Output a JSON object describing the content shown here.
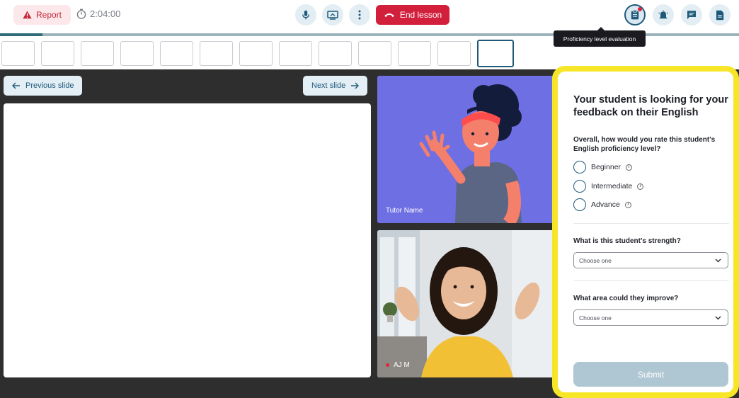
{
  "header": {
    "report_label": "Report",
    "timer": "2:04:00",
    "end_lesson_label": "End lesson"
  },
  "tooltip": "Proficiency level evaluation",
  "lesson": {
    "progress": 0.057,
    "slide_count": 13,
    "current_slide": 13,
    "prev_slide_label": "Previous slide",
    "next_slide_label": "Next slide"
  },
  "videos": {
    "tutor_name": "Tutor Name",
    "student_name": "AJ M"
  },
  "feedback": {
    "title": "Your student is looking for your feedback on their English",
    "q1": "Overall, how would you rate this student's English proficiency level?",
    "levels": [
      "Beginner",
      "Intermediate",
      "Advance"
    ],
    "q2": "What is this student's strength?",
    "q2_placeholder": "Choose one",
    "q3": "What area could they improve?",
    "q3_placeholder": "Choose one",
    "submit_label": "Submit"
  },
  "colors": {
    "accent": "#1f5a7a",
    "danger": "#d21f3c",
    "highlight": "#f7e627",
    "tutor_bg": "#6f6fe4"
  }
}
